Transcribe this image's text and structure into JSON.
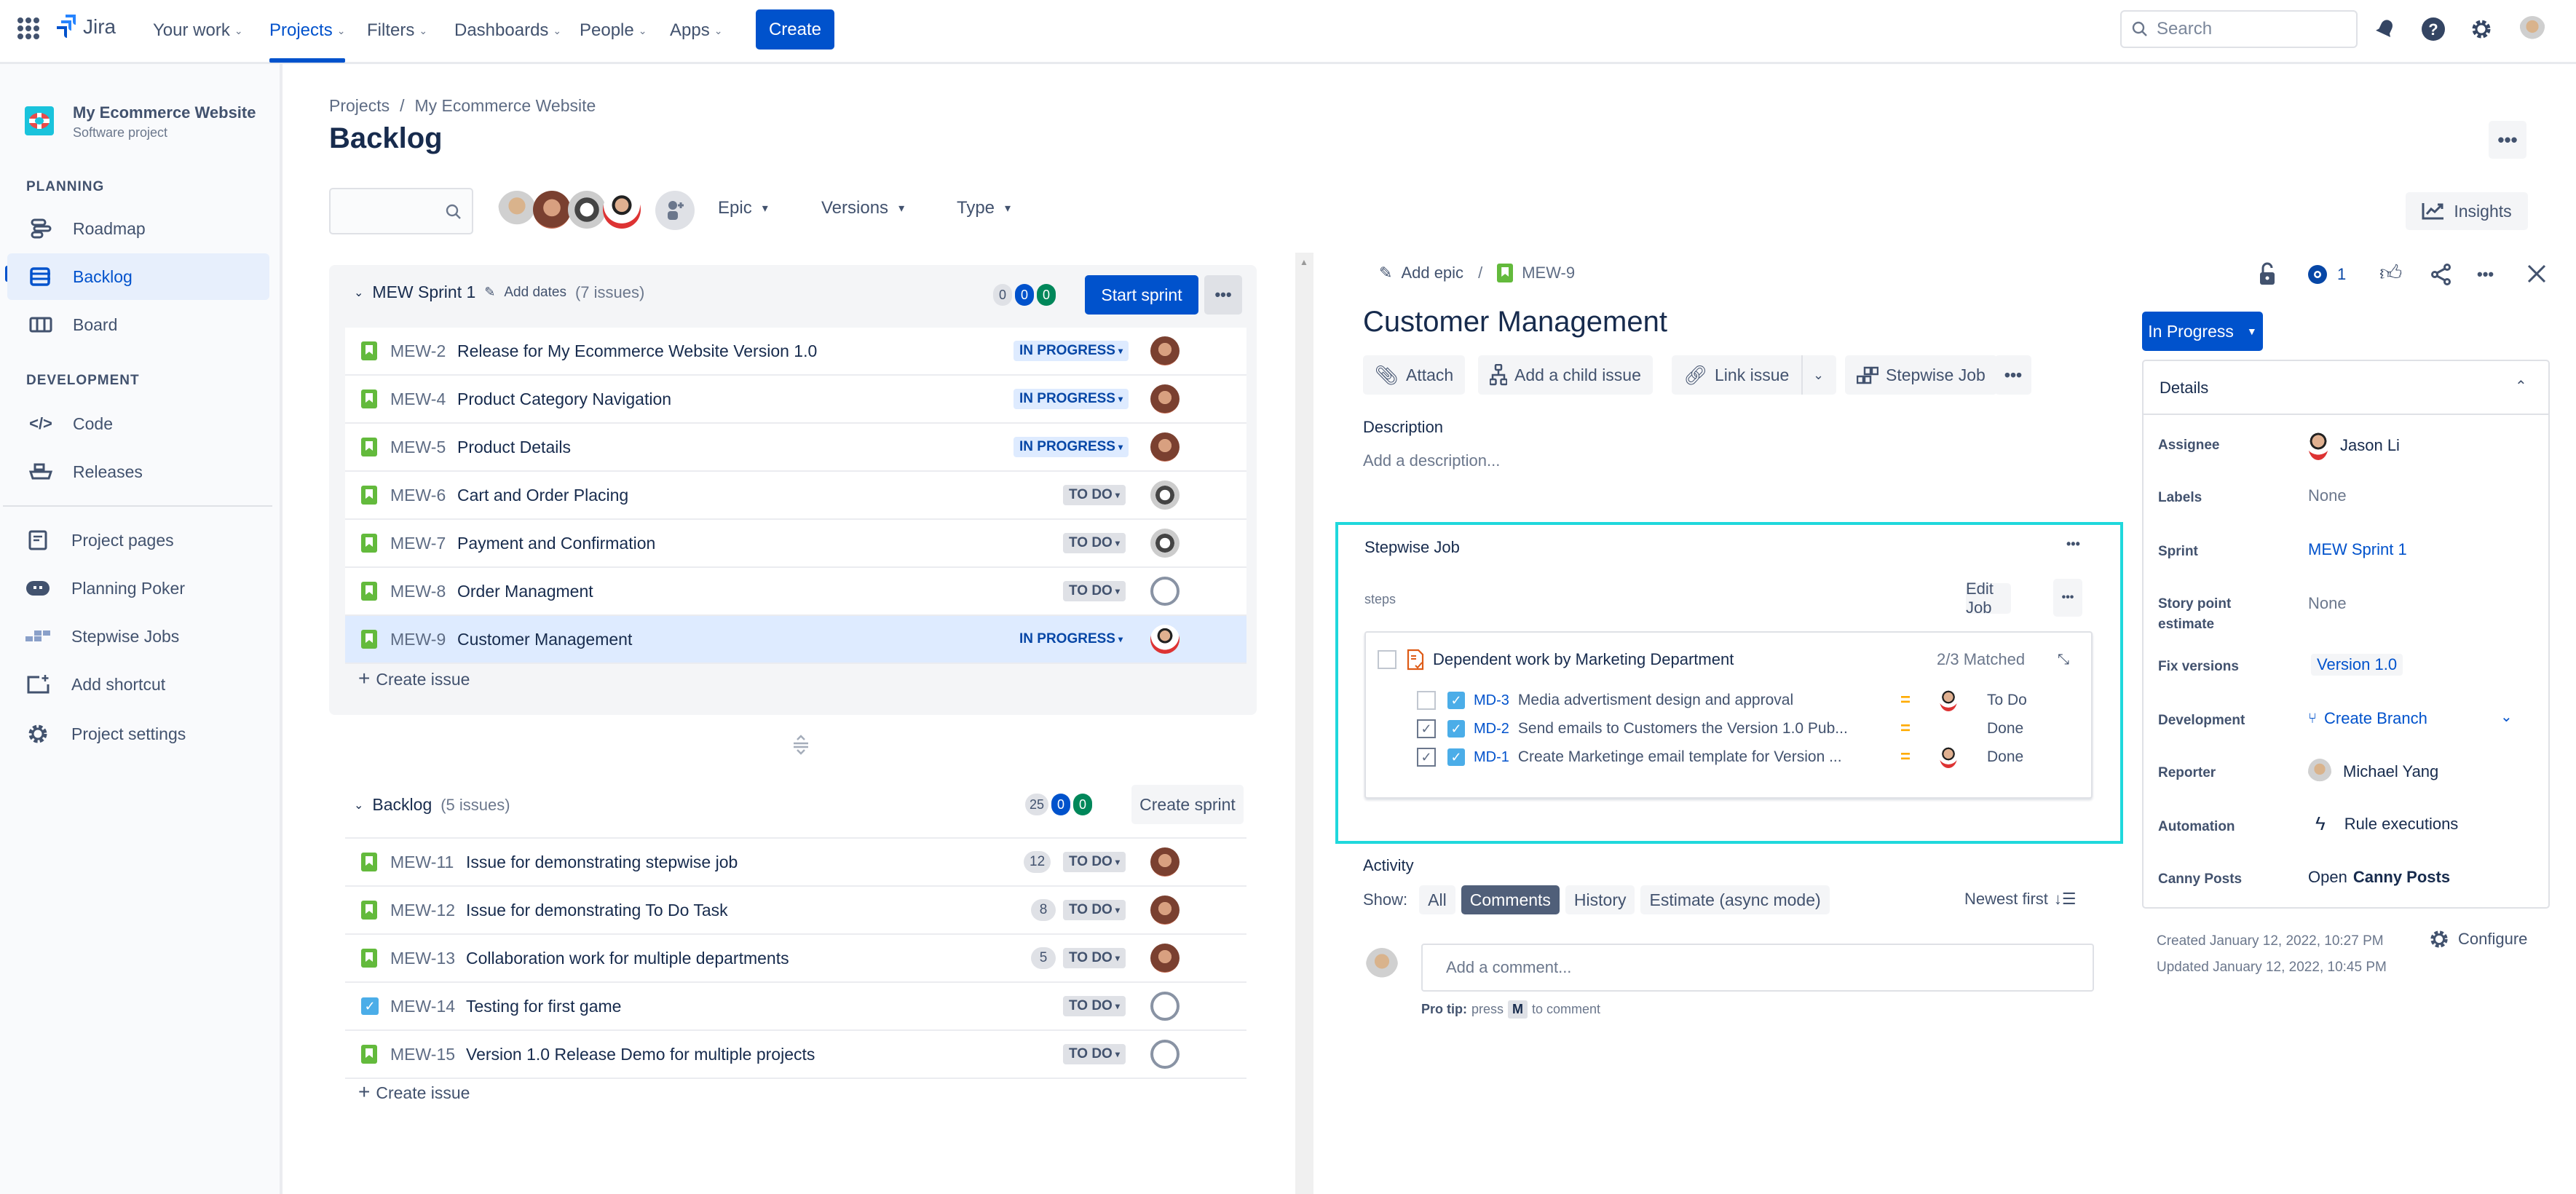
{
  "topnav": {
    "app_name": "Jira",
    "items": [
      {
        "label": "Your work",
        "active": false
      },
      {
        "label": "Projects",
        "active": true
      },
      {
        "label": "Filters",
        "active": false
      },
      {
        "label": "Dashboards",
        "active": false
      },
      {
        "label": "People",
        "active": false
      },
      {
        "label": "Apps",
        "active": false
      }
    ],
    "create_label": "Create",
    "search_placeholder": "Search",
    "icons": [
      "notifications-icon",
      "help-icon",
      "settings-icon",
      "user-avatar"
    ]
  },
  "sidebar": {
    "project_name": "My Ecommerce Website",
    "project_type": "Software project",
    "planning_heading": "PLANNING",
    "development_heading": "DEVELOPMENT",
    "planning_items": [
      {
        "label": "Roadmap",
        "icon": "roadmap-icon"
      },
      {
        "label": "Backlog",
        "icon": "backlog-icon",
        "active": true
      },
      {
        "label": "Board",
        "icon": "board-icon"
      }
    ],
    "development_items": [
      {
        "label": "Code",
        "icon": "code-icon"
      },
      {
        "label": "Releases",
        "icon": "releases-icon"
      }
    ],
    "other_items": [
      {
        "label": "Project pages",
        "icon": "pages-icon"
      },
      {
        "label": "Planning Poker",
        "icon": "poker-icon"
      },
      {
        "label": "Stepwise Jobs",
        "icon": "stepwise-icon"
      },
      {
        "label": "Add shortcut",
        "icon": "add-shortcut-icon"
      },
      {
        "label": "Project settings",
        "icon": "settings-icon"
      }
    ]
  },
  "breadcrumb": {
    "root": "Projects",
    "separator": "/",
    "project": "My Ecommerce Website"
  },
  "page_title": "Backlog",
  "filters": {
    "search_placeholder": "",
    "epic": "Epic",
    "versions": "Versions",
    "type": "Type",
    "insights": "Insights"
  },
  "sprint": {
    "name": "MEW Sprint 1",
    "add_dates": "Add dates",
    "count_label": "(7 issues)",
    "counts": {
      "todo": "0",
      "in_progress": "0",
      "done": "0"
    },
    "start_label": "Start sprint",
    "create_issue": "Create issue",
    "issues": [
      {
        "key": "MEW-2",
        "summary": "Release for My Ecommerce Website Version 1.0",
        "status": "IN PROGRESS",
        "type": "story",
        "assignee": "girl"
      },
      {
        "key": "MEW-4",
        "summary": "Product Category Navigation",
        "status": "IN PROGRESS",
        "type": "story",
        "assignee": "girl"
      },
      {
        "key": "MEW-5",
        "summary": "Product Details",
        "status": "IN PROGRESS",
        "type": "story",
        "assignee": "girl"
      },
      {
        "key": "MEW-6",
        "summary": "Cart and Order Placing",
        "status": "TO DO",
        "type": "story",
        "assignee": "penguin"
      },
      {
        "key": "MEW-7",
        "summary": "Payment and Confirmation",
        "status": "TO DO",
        "type": "story",
        "assignee": "penguin"
      },
      {
        "key": "MEW-8",
        "summary": "Order Managment",
        "status": "TO DO",
        "type": "story",
        "assignee": "unassigned"
      },
      {
        "key": "MEW-9",
        "summary": "Customer Management",
        "status": "IN PROGRESS",
        "type": "story",
        "assignee": "boy",
        "selected": true
      }
    ]
  },
  "backlog": {
    "name": "Backlog",
    "count_label": "(5 issues)",
    "counts": {
      "todo": "25",
      "in_progress": "0",
      "done": "0"
    },
    "create_sprint_label": "Create sprint",
    "create_issue": "Create issue",
    "issues": [
      {
        "key": "MEW-11",
        "summary": "Issue for demonstrating stepwise job",
        "estimate": "12",
        "status": "TO DO",
        "type": "story",
        "assignee": "girl"
      },
      {
        "key": "MEW-12",
        "summary": "Issue for demonstrating To Do Task",
        "estimate": "8",
        "status": "TO DO",
        "type": "story",
        "assignee": "girl"
      },
      {
        "key": "MEW-13",
        "summary": "Collaboration work for multiple departments",
        "estimate": "5",
        "status": "TO DO",
        "type": "story",
        "assignee": "girl"
      },
      {
        "key": "MEW-14",
        "summary": "Testing for first game",
        "estimate": "",
        "status": "TO DO",
        "type": "task",
        "assignee": "unassigned"
      },
      {
        "key": "MEW-15",
        "summary": "Version 1.0 Release Demo for multiple projects",
        "estimate": "",
        "status": "TO DO",
        "type": "story",
        "assignee": "unassigned"
      }
    ]
  },
  "detail": {
    "add_epic": "Add epic",
    "issue_key": "MEW-9",
    "watch_count": "1",
    "title": "Customer Management",
    "toolbar": {
      "attach": "Attach",
      "add_child": "Add a child issue",
      "link_issue": "Link issue",
      "stepwise_job": "Stepwise Job"
    },
    "status_button": "In Progress",
    "description_heading": "Description",
    "description_placeholder": "Add a description...",
    "stepwise": {
      "title": "Stepwise Job",
      "steps_label": "steps",
      "edit_label": "Edit Job",
      "group_title": "Dependent work by Marketing Department",
      "matched": "2/3 Matched",
      "items": [
        {
          "key": "MD-3",
          "summary": "Media advertisment design and approval",
          "status": "To Do",
          "checked": false,
          "has_avatar": true
        },
        {
          "key": "MD-2",
          "summary": "Send emails to Customers the Version 1.0 Pub...",
          "status": "Done",
          "checked": true,
          "has_avatar": false
        },
        {
          "key": "MD-1",
          "summary": "Create Marketinge email template for Version ...",
          "status": "Done",
          "checked": true,
          "has_avatar": true
        }
      ]
    },
    "activity": {
      "heading": "Activity",
      "show_label": "Show:",
      "tabs": [
        {
          "label": "All",
          "selected": false
        },
        {
          "label": "Comments",
          "selected": true
        },
        {
          "label": "History",
          "selected": false
        },
        {
          "label": "Estimate (async mode)",
          "selected": false
        }
      ],
      "sort_label": "Newest first",
      "comment_placeholder": "Add a comment...",
      "pro_tip_bold": "Pro tip:",
      "pro_tip_press": "press",
      "pro_tip_key": "M",
      "pro_tip_rest": "to comment"
    },
    "details_panel": {
      "heading": "Details",
      "fields": {
        "assignee_label": "Assignee",
        "assignee": "Jason Li",
        "labels_label": "Labels",
        "labels": "None",
        "sprint_label": "Sprint",
        "sprint": "MEW Sprint 1",
        "story_points_label": "Story point estimate",
        "story_points": "None",
        "fix_versions_label": "Fix versions",
        "fix_versions": "Version 1.0",
        "development_label": "Development",
        "development": "Create Branch",
        "reporter_label": "Reporter",
        "reporter": "Michael Yang",
        "automation_label": "Automation",
        "automation": "Rule executions",
        "canny_label": "Canny Posts",
        "canny_open": "Open",
        "canny_bold": "Canny Posts"
      }
    },
    "created": "Created January 12, 2022, 10:27 PM",
    "updated": "Updated January 12, 2022, 10:45 PM",
    "configure": "Configure"
  },
  "colors": {
    "brand": "#0052cc",
    "story": "#63ba3c",
    "task": "#4bade8",
    "highlight": "#1fd8dc",
    "selected_row": "#deebff"
  }
}
